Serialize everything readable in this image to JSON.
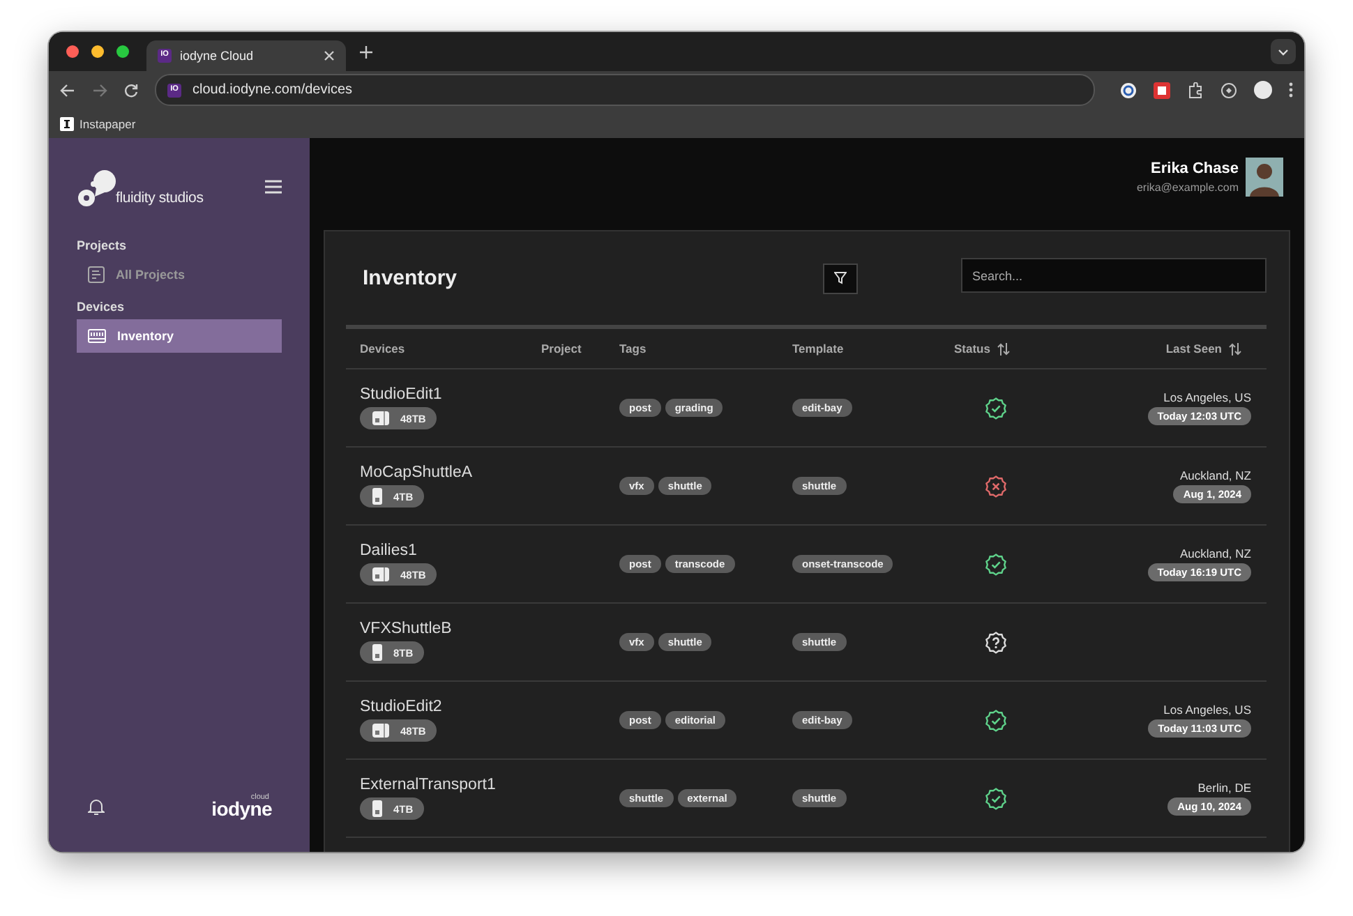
{
  "browser": {
    "tabs": [
      {
        "title": "iodyne Cloud",
        "favicon": "IO",
        "selected": true
      }
    ],
    "url": "cloud.iodyne.com/devices",
    "url_favicon": "IO",
    "bookmarks": [
      {
        "label": "Instapaper"
      }
    ]
  },
  "sidebar": {
    "brand": "fluidity studios",
    "sections": [
      {
        "heading": "Projects",
        "items": [
          {
            "label": "All Projects",
            "kind": "list",
            "selected": false
          }
        ]
      },
      {
        "heading": "Devices",
        "items": [
          {
            "label": "Inventory",
            "kind": "rack",
            "selected": true
          }
        ]
      }
    ],
    "footer_logo": "iodyne",
    "footer_logo_sup": "cloud"
  },
  "user": {
    "name": "Erika Chase",
    "email": "erika@example.com"
  },
  "inventory": {
    "title": "Inventory",
    "search": {
      "placeholder": "Search..."
    },
    "columns": [
      {
        "label": "Devices",
        "sortable": false
      },
      {
        "label": "Project",
        "sortable": false
      },
      {
        "label": "Tags",
        "sortable": false
      },
      {
        "label": "Template",
        "sortable": false
      },
      {
        "label": "Status",
        "sortable": true
      },
      {
        "label": "Last Seen",
        "sortable": true
      }
    ],
    "rows": [
      {
        "name": "StudioEdit1",
        "capacity": {
          "kind": "desktop",
          "label": "48TB"
        },
        "tags": [
          "post",
          "grading"
        ],
        "template": "edit-bay",
        "status": {
          "kind": "ok"
        },
        "location": "Los Angeles, US",
        "last_seen": "Today 12:03 UTC"
      },
      {
        "name": "MoCapShuttleA",
        "capacity": {
          "kind": "portable",
          "label": "4TB"
        },
        "tags": [
          "vfx",
          "shuttle"
        ],
        "template": "shuttle",
        "status": {
          "kind": "error"
        },
        "location": "Auckland, NZ",
        "last_seen": "Aug 1, 2024"
      },
      {
        "name": "Dailies1",
        "capacity": {
          "kind": "desktop",
          "label": "48TB"
        },
        "tags": [
          "post",
          "transcode"
        ],
        "template": "onset-transcode",
        "status": {
          "kind": "ok"
        },
        "location": "Auckland, NZ",
        "last_seen": "Today 16:19 UTC"
      },
      {
        "name": "VFXShuttleB",
        "capacity": {
          "kind": "portable",
          "label": "8TB"
        },
        "tags": [
          "vfx",
          "shuttle"
        ],
        "template": "shuttle",
        "status": {
          "kind": "unknown"
        }
      },
      {
        "name": "StudioEdit2",
        "capacity": {
          "kind": "desktop",
          "label": "48TB"
        },
        "tags": [
          "post",
          "editorial"
        ],
        "template": "edit-bay",
        "status": {
          "kind": "ok"
        },
        "location": "Los Angeles, US",
        "last_seen": "Today 11:03 UTC"
      },
      {
        "name": "ExternalTransport1",
        "capacity": {
          "kind": "portable",
          "label": "4TB"
        },
        "tags": [
          "shuttle",
          "external"
        ],
        "template": "shuttle",
        "status": {
          "kind": "ok"
        },
        "location": "Berlin, DE",
        "last_seen": "Aug 10, 2024"
      }
    ]
  }
}
